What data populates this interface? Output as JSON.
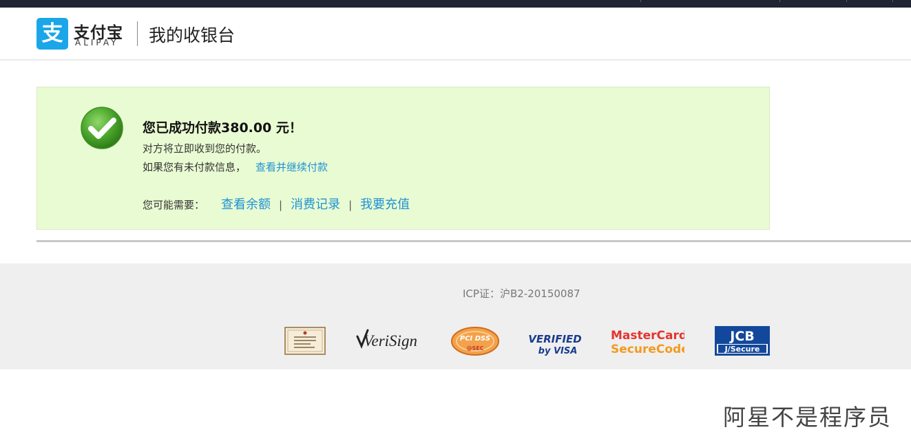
{
  "header": {
    "logo_glyph": "支",
    "logo_cn": "支付宝",
    "logo_en": "ALIPAY",
    "title": "我的收银台"
  },
  "success": {
    "title": "您已成功付款380.00 元！",
    "line1": "对方将立即收到您的付款。",
    "line2": "如果您有未付款信息，",
    "line2_link": "查看并继续付款",
    "need_label": "您可能需要：",
    "links": [
      "查看余额",
      "消费记录",
      "我要充值"
    ],
    "separator": "|"
  },
  "footer": {
    "icp": "ICP证：沪B2-20150087",
    "badges": {
      "verisign": "VeriSign",
      "pcidss_top": "PCI DSS",
      "pcidss_bottom": "@SEC",
      "visa_top": "VERIFIED",
      "visa_bottom": "by VISA",
      "mc_top": "MasterCard.",
      "mc_bottom": "SecureCode.",
      "jcb_top": "JCB",
      "jcb_bottom": "J/Secure"
    }
  },
  "watermark": "阿星不是程序员",
  "colors": {
    "alipay_blue": "#1aa6e8",
    "success_bg": "#e9fbd2",
    "link_blue": "#1e92d6",
    "check_green": "#4aa52b"
  }
}
